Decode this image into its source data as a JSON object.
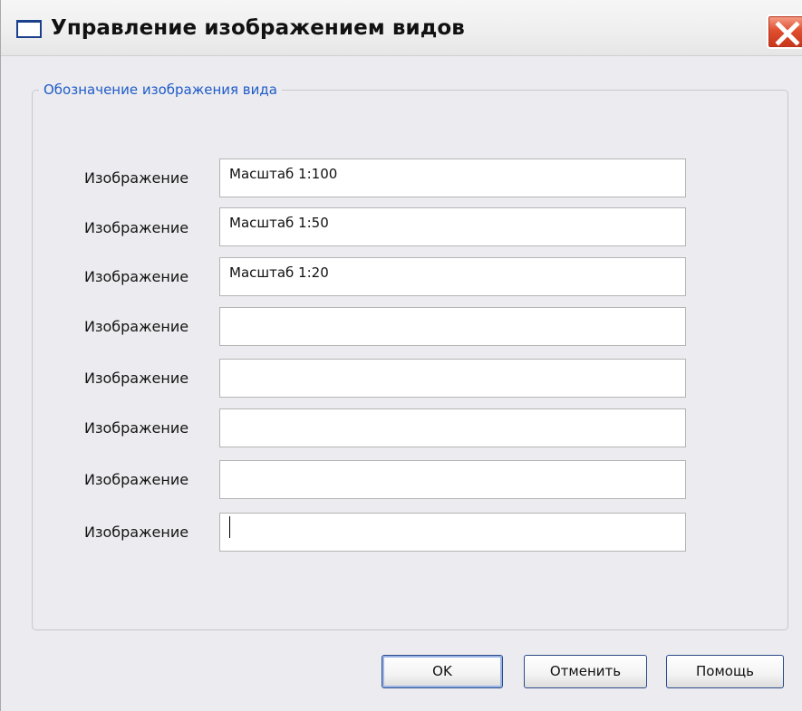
{
  "window": {
    "title": "Управление изображением видов",
    "icon": "window-icon",
    "close_icon": "close-icon"
  },
  "group": {
    "legend": "Обозначение изображения вида"
  },
  "rows": [
    {
      "label": "Изображение",
      "value": "Масштаб 1:100"
    },
    {
      "label": "Изображение",
      "value": "Масштаб 1:50"
    },
    {
      "label": "Изображение",
      "value": "Масштаб 1:20"
    },
    {
      "label": "Изображение",
      "value": ""
    },
    {
      "label": "Изображение",
      "value": ""
    },
    {
      "label": "Изображение",
      "value": ""
    },
    {
      "label": "Изображение",
      "value": ""
    },
    {
      "label": "Изображение",
      "value": ""
    }
  ],
  "buttons": {
    "ok": "OK",
    "cancel": "Отменить",
    "help": "Помощь"
  },
  "colors": {
    "legend": "#1e5cc8",
    "close_button": "#d9462a",
    "dialog_background": "#ecebef"
  }
}
